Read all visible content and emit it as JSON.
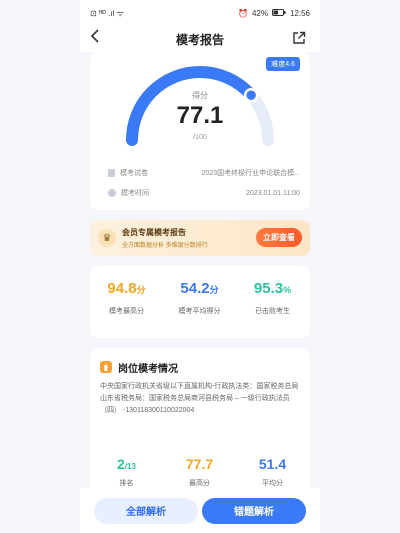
{
  "statusbar": {
    "left": "⊡ ᴴᴰ .ıl ᯤ",
    "battery": "42%",
    "time": "12:56"
  },
  "navbar": {
    "title": "模考报告"
  },
  "score": {
    "difficulty": "难度4.6",
    "label": "得分",
    "value": "77.1",
    "total": "/100",
    "gauge_fraction": 0.771,
    "paper_label": "模考试卷",
    "paper_value": "2023国考终极行业申论联合模...",
    "time_label": "模考时间",
    "time_value": "2023.01.01 11:00"
  },
  "vip": {
    "title": "会员专属模考报告",
    "subtitle": "全方面数据分析  多维度分数排行",
    "button": "立即查看"
  },
  "stats": [
    {
      "value": "94.8",
      "unit": "分",
      "caption": "模考最高分",
      "color": "#f5a623"
    },
    {
      "value": "54.2",
      "unit": "分",
      "caption": "模考平均得分",
      "color": "#3a7af6"
    },
    {
      "value": "95.3",
      "unit": "%",
      "caption": "已击败考生",
      "color": "#2bc3a0"
    }
  ],
  "post": {
    "title": "岗位模考情况",
    "description": "中央国家行政机关省级以下直属机构-行政执法类：国家税务总局山东省税务局：国家税务总局商河县税务局 – 一级行政执法员（四） -130118300110022004",
    "stats": [
      {
        "value": "2",
        "unit": "/13",
        "caption": "排名",
        "color": "#2bc3a0"
      },
      {
        "value": "77.7",
        "unit": "",
        "caption": "最高分",
        "color": "#f5a623"
      },
      {
        "value": "51.4",
        "unit": "",
        "caption": "平均分",
        "color": "#3a7af6"
      }
    ]
  },
  "bottom": {
    "all_label": "全部解析",
    "wrong_label": "错题解析"
  },
  "colors": {
    "accent": "#3a7af6",
    "orange": "#f5a623",
    "teal": "#2bc3a0"
  }
}
